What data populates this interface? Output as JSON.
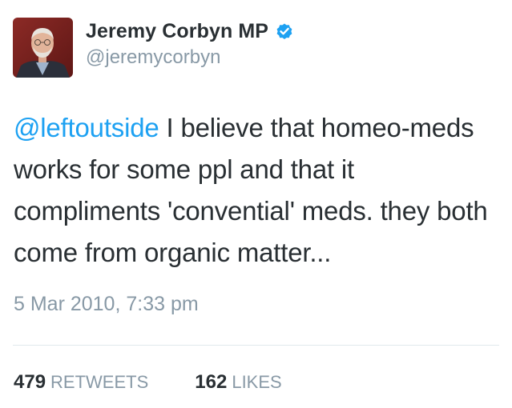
{
  "user": {
    "display_name": "Jeremy Corbyn MP",
    "handle": "@jeremycorbyn",
    "verified": true,
    "avatar_icon": "profile-photo-avatar"
  },
  "tweet": {
    "mention": "@leftoutside",
    "text": " I believe that homeo-meds works for some ppl and that it compliments 'convential' meds. they both come from organic matter...",
    "timestamp": "5 Mar 2010, 7:33 pm"
  },
  "stats": {
    "retweets_count": "479",
    "retweets_label": "RETWEETS",
    "likes_count": "162",
    "likes_label": "LIKES"
  },
  "colors": {
    "accent": "#1da1f2",
    "text": "#292f33",
    "muted": "#8899a6",
    "divider": "#e1e8ed"
  }
}
